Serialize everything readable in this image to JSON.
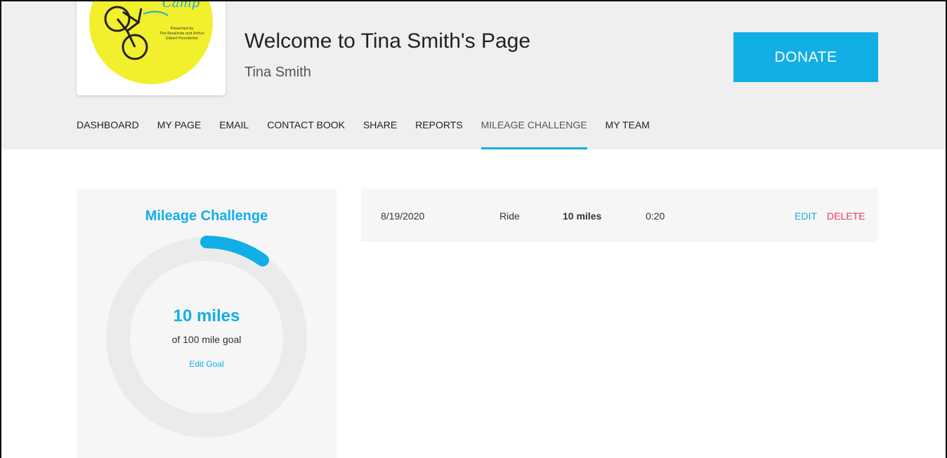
{
  "header": {
    "title": "Welcome to Tina Smith's Page",
    "subtitle": "Tina Smith",
    "donate_label": "DONATE",
    "logo": {
      "word": "Camp",
      "credit_lines": [
        "Presented by",
        "The Rosalinde and Arthur",
        "Gilbert Foundation"
      ]
    }
  },
  "nav": {
    "items": [
      "DASHBOARD",
      "MY PAGE",
      "EMAIL",
      "CONTACT BOOK",
      "SHARE",
      "REPORTS",
      "MILEAGE CHALLENGE",
      "MY TEAM"
    ],
    "active": "MILEAGE CHALLENGE"
  },
  "challenge": {
    "title": "Mileage Challenge",
    "miles_label": "10 miles",
    "goal_label": "of 100 mile goal",
    "edit_goal_label": "Edit Goal",
    "progress_fraction": 0.1
  },
  "entries": [
    {
      "date": "8/19/2020",
      "type": "Ride",
      "distance": "10 miles",
      "time": "0:20",
      "edit_label": "EDIT",
      "delete_label": "DELETE"
    }
  ],
  "colors": {
    "accent": "#12aee6",
    "delete": "#e8385e",
    "header_bg": "#efefef",
    "card_bg": "#f6f6f6",
    "logo_yellow": "#f2ef2c"
  }
}
